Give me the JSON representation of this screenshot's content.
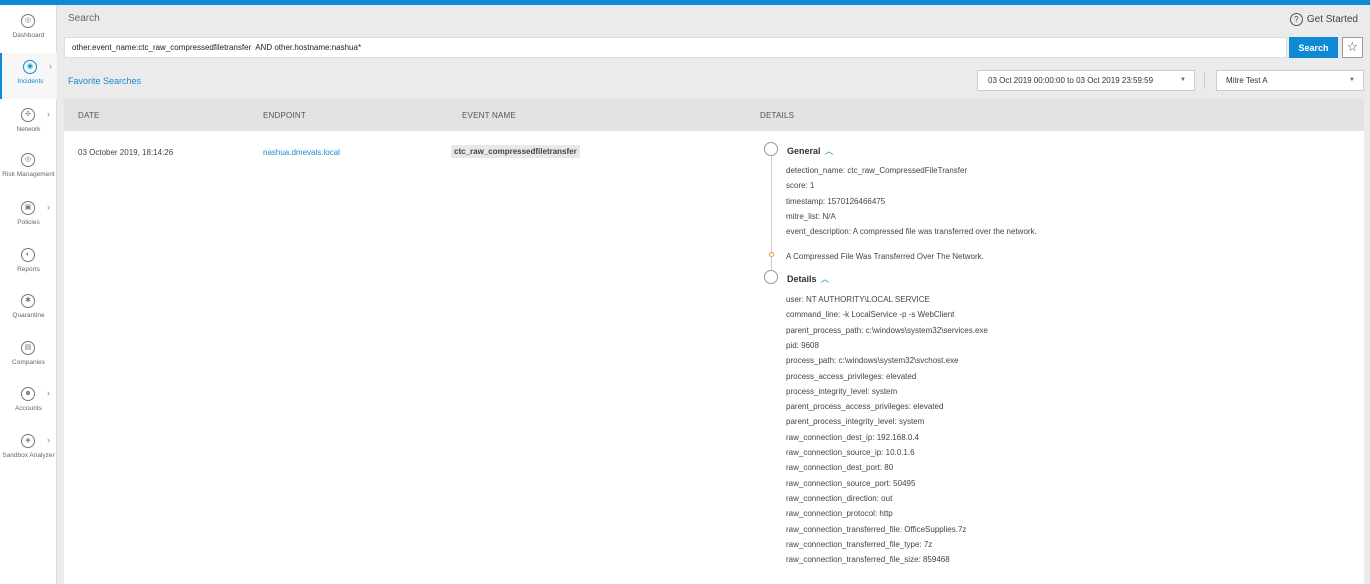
{
  "sidebar": {
    "items": [
      {
        "label": "Dashboard",
        "icon": "dashboard-icon",
        "glyph": "◎",
        "has_submenu": false,
        "active": false
      },
      {
        "label": "Incidents",
        "icon": "incidents-icon",
        "glyph": "◉",
        "has_submenu": true,
        "active": true
      },
      {
        "label": "Network",
        "icon": "network-icon",
        "glyph": "✣",
        "has_submenu": true,
        "active": false
      },
      {
        "label": "Risk Management",
        "icon": "risk-management-icon",
        "glyph": "◎",
        "has_submenu": false,
        "active": false
      },
      {
        "label": "Policies",
        "icon": "policies-icon",
        "glyph": "▣",
        "has_submenu": true,
        "active": false
      },
      {
        "label": "Reports",
        "icon": "reports-icon",
        "glyph": "◐",
        "has_submenu": false,
        "active": false
      },
      {
        "label": "Quarantine",
        "icon": "quarantine-icon",
        "glyph": "✱",
        "has_submenu": false,
        "active": false
      },
      {
        "label": "Companies",
        "icon": "companies-icon",
        "glyph": "▤",
        "has_submenu": false,
        "active": false
      },
      {
        "label": "Accounts",
        "icon": "accounts-icon",
        "glyph": "☻",
        "has_submenu": true,
        "active": false
      },
      {
        "label": "Sandbox Analyzer",
        "icon": "sandbox-analyzer-icon",
        "glyph": "◈",
        "has_submenu": true,
        "active": false
      }
    ]
  },
  "header": {
    "title": "Search",
    "get_started": "Get Started",
    "help_glyph": "?"
  },
  "search": {
    "query": "other.event_name:ctc_raw_compressedfiletransfer  AND other.hostname:nashua*",
    "button": "Search",
    "star_glyph": "☆"
  },
  "filters": {
    "favorite_searches": "Favorite Searches",
    "date_range": "03 Oct 2019 00:00:00 to 03 Oct 2019 23:59:59",
    "company": "Mitre Test A"
  },
  "table": {
    "headers": {
      "date": "DATE",
      "endpoint": "ENDPOINT",
      "event_name": "EVENT NAME",
      "details": "DETAILS"
    },
    "row": {
      "date": "03 October 2019, 18:14:26",
      "endpoint": "nashua.dmevals.local",
      "event_name": "ctc_raw_compressedfiletransfer"
    }
  },
  "details": {
    "general_title": "General",
    "general_fields": [
      "detection_name:  ctc_raw_CompressedFileTransfer",
      "score:  1",
      "timestamp:  1570126466475",
      "mitre_list:  N/A",
      "event_description:  A compressed file was transferred over the network."
    ],
    "summary": "A Compressed File Was Transferred Over The Network.",
    "details_title": "Details",
    "details_fields": [
      "user:  NT AUTHORITY\\LOCAL SERVICE",
      "command_line:  -k LocalService -p -s WebClient",
      "parent_process_path:  c:\\windows\\system32\\services.exe",
      "pid:  9608",
      "process_path:  c:\\windows\\system32\\svchost.exe",
      "process_access_privileges:  elevated",
      "process_integrity_level:  system",
      "parent_process_access_privileges:  elevated",
      "parent_process_integrity_level:  system",
      "raw_connection_dest_ip:  192.168.0.4",
      "raw_connection_source_ip:  10.0.1.6",
      "raw_connection_dest_port:  80",
      "raw_connection_source_port:  50495",
      "raw_connection_direction:  out",
      "raw_connection_protocol:  http",
      "raw_connection_transferred_file:  OfficeSupplies.7z",
      "raw_connection_transferred_file_type:  7z",
      "raw_connection_transferred_file_size:  859468"
    ]
  },
  "colors": {
    "accent": "#0e8ad4",
    "link": "#1a8bd1",
    "timeline_dot": "#e8a020"
  }
}
